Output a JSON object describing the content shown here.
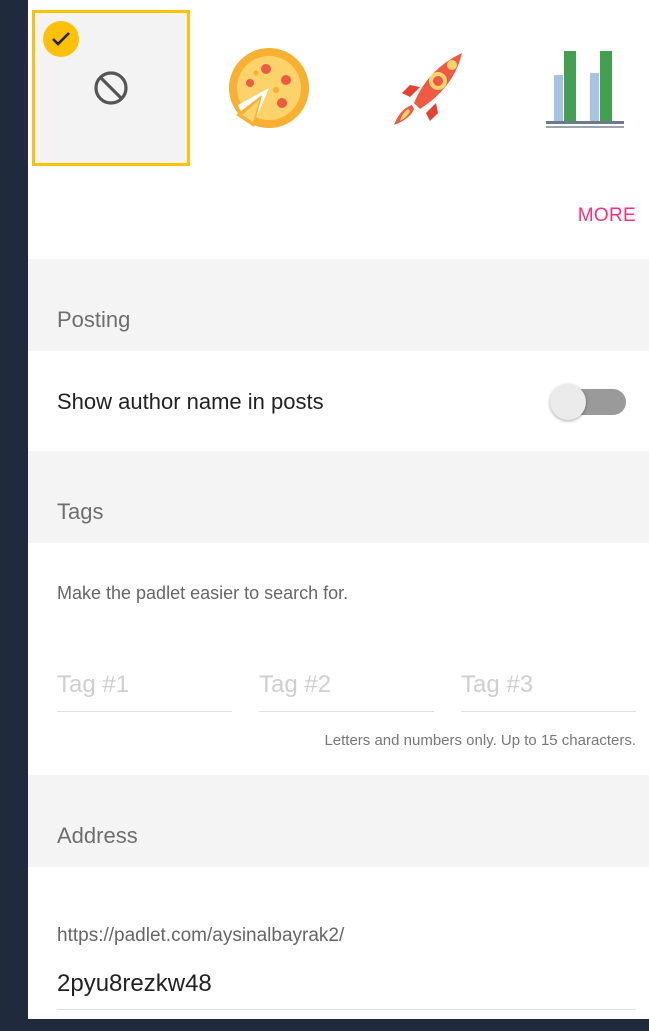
{
  "wallpaper_icons": [
    {
      "name": "none",
      "selected": true
    },
    {
      "name": "pizza",
      "selected": false
    },
    {
      "name": "rocket",
      "selected": false
    },
    {
      "name": "bar-chart",
      "selected": false
    }
  ],
  "more_label": "MORE",
  "posting": {
    "header": "Posting",
    "show_author_label": "Show author name in posts",
    "show_author_enabled": false
  },
  "tags": {
    "header": "Tags",
    "description": "Make the padlet easier to search for.",
    "placeholders": [
      "Tag #1",
      "Tag #2",
      "Tag #3"
    ],
    "values": [
      "",
      "",
      ""
    ],
    "note": "Letters and numbers only. Up to 15 characters."
  },
  "address": {
    "header": "Address",
    "prefix": "https://padlet.com/aysinalbayrak2/",
    "slug": "2pyu8rezkw48"
  },
  "colors": {
    "accent": "#ffc107",
    "link": "#ff2e7d",
    "background": "#1f2a3c"
  }
}
